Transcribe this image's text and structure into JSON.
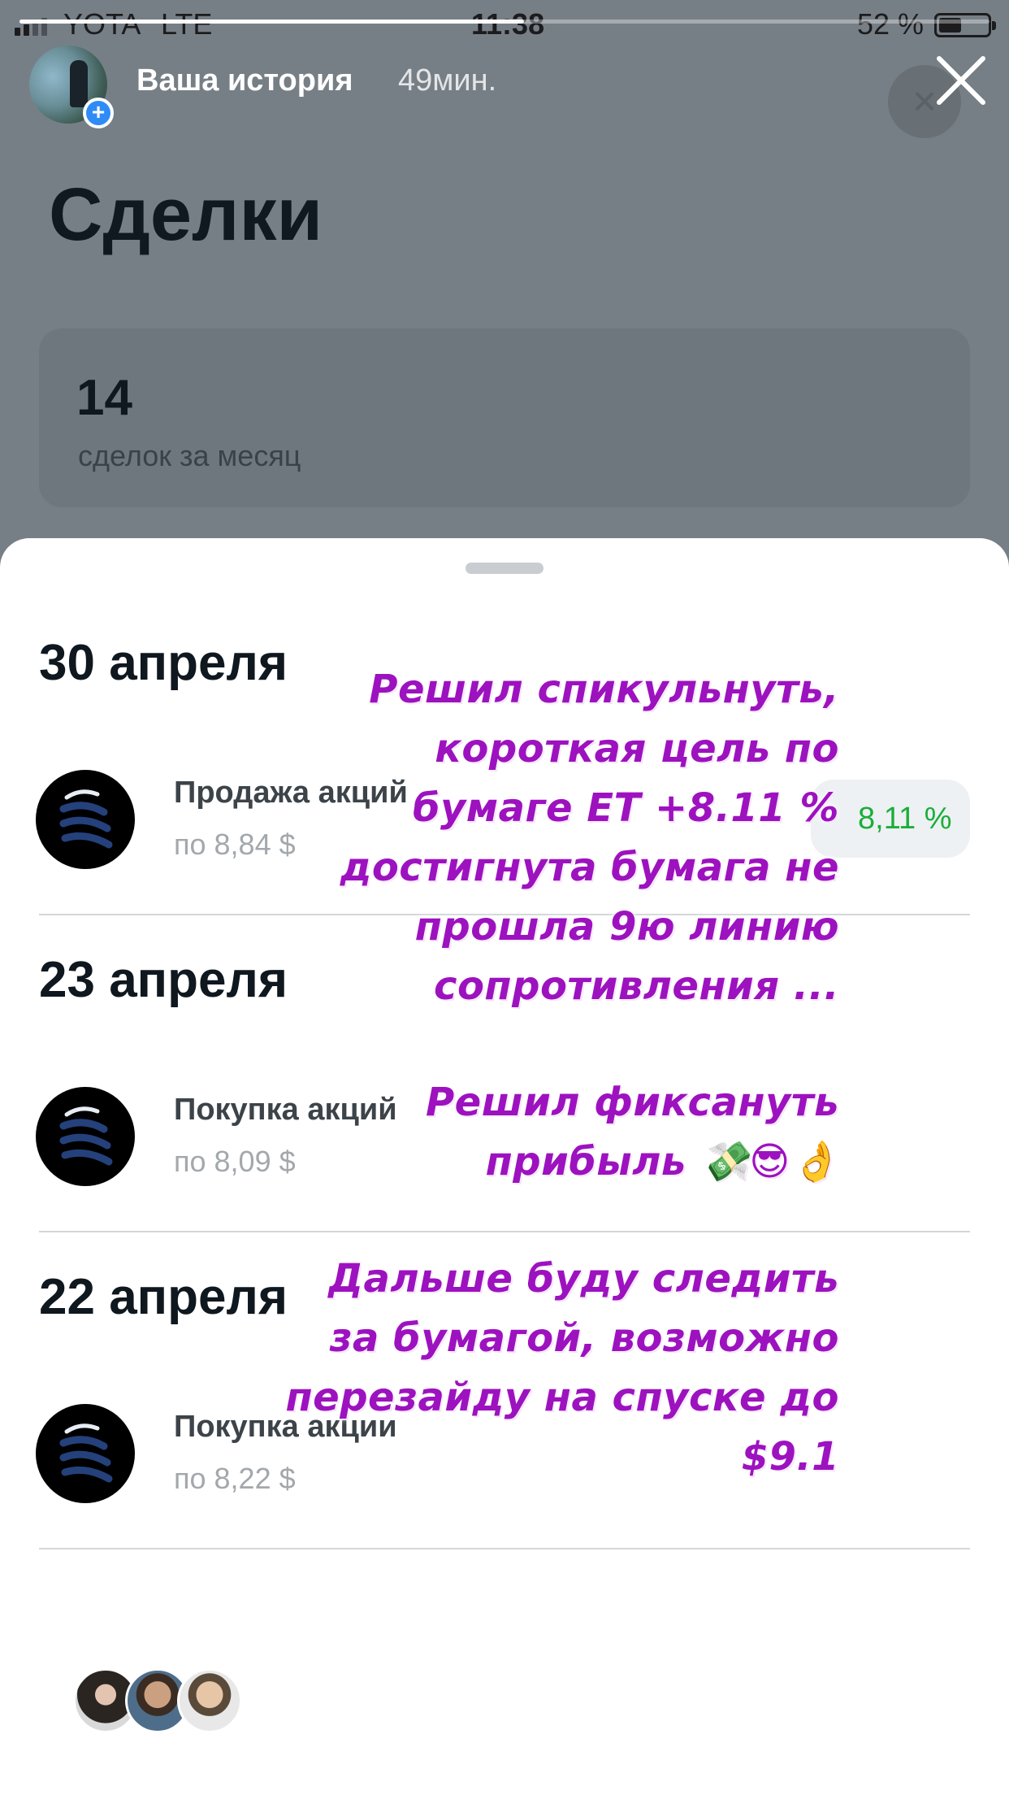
{
  "status_bar": {
    "carrier": "YOTA",
    "network": "LTE",
    "time": "11:38",
    "battery_percent_text": "52 %",
    "battery_level": 0.52
  },
  "story": {
    "user": "Ваша история",
    "time_ago": "49мин.",
    "progress": 0.52,
    "add_icon": "plus-icon",
    "close_icon": "close-x-icon"
  },
  "app": {
    "title": "Сделки",
    "close_icon": "×",
    "stat": {
      "value": "14",
      "label": "сделок за месяц"
    }
  },
  "deals": [
    {
      "date": "30 апреля",
      "operation": "Продажа акций",
      "price": "по 8,84 $",
      "badge": "8,11 %"
    },
    {
      "date": "23 апреля",
      "operation": "Покупка акций",
      "price": "по 8,09 $"
    },
    {
      "date": "22 апреля",
      "operation": "Покупка акции",
      "price": "по 8,22 $"
    }
  ],
  "notes": [
    {
      "lines": [
        "Решил спикульнуть,",
        "короткая цель  по",
        "бумаге ET +8.11 %",
        "достигнута  бумага не",
        "прошла  9ю линию",
        "сопротивления ..."
      ]
    },
    {
      "lines": [
        "Решил  фиксануть",
        "прибыль 💸😎👌"
      ]
    },
    {
      "lines": [
        "Дальше буду следить",
        "за бумагой, возможно",
        "перезайду на спуске до",
        "$9.1"
      ]
    }
  ],
  "colors": {
    "accent_note": "#9d12bf",
    "positive": "#1aae39",
    "badge_blue": "#2f8cf6"
  }
}
